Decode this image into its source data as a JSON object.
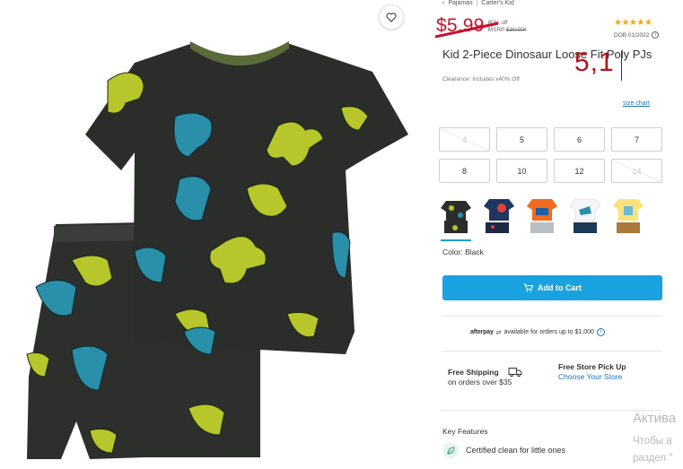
{
  "breadcrumb": {
    "items": [
      "Pajamas",
      "Carter's Kid"
    ],
    "separator": "|"
  },
  "price": {
    "current": "$5.99",
    "discount": "80% off",
    "msrp_label": "MSRP",
    "msrp_value": "$30.00*"
  },
  "rating": {
    "stars": "★★★★★",
    "value": 5,
    "max": 5
  },
  "dob": "DOB 01/2022",
  "product": {
    "title": "Kid 2-Piece Dinosaur Loose Fit Poly PJs",
    "clearance": "Clearance: Includes x40% Off"
  },
  "overlay_number": "5,1",
  "size_chart_label": "size chart",
  "sizes": [
    {
      "label": "4",
      "available": false
    },
    {
      "label": "5",
      "available": true
    },
    {
      "label": "6",
      "available": true
    },
    {
      "label": "7",
      "available": true
    },
    {
      "label": "8",
      "available": true
    },
    {
      "label": "10",
      "available": true
    },
    {
      "label": "12",
      "available": true
    },
    {
      "label": "14",
      "available": false
    }
  ],
  "swatches": [
    "black-dino",
    "navy-shark",
    "orange-truck",
    "white-dino",
    "yellow-dino"
  ],
  "color": {
    "label": "Color:",
    "value": "Black"
  },
  "cart_button": "Add to Cart",
  "afterpay": {
    "brand": "afterpay",
    "text": "available for orders up to $1,000"
  },
  "shipping": {
    "title": "Free Shipping",
    "detail": "on orders over $35"
  },
  "pickup": {
    "title": "Free Store Pick Up",
    "link": "Choose Your Store"
  },
  "key_features": {
    "heading": "Key Features",
    "items": [
      "Certified clean for little ones"
    ]
  },
  "watermark": {
    "line1": "Актива",
    "line2": "Чтобы а",
    "line3": "раздел \""
  },
  "colors": {
    "accent": "#1aa2e0",
    "price_red": "#c8102e",
    "star": "#f2a900",
    "link": "#1a75bb",
    "shirt": "#2a2d2a",
    "dino_yellow": "#b7c62a",
    "dino_blue": "#2a8fa8"
  }
}
